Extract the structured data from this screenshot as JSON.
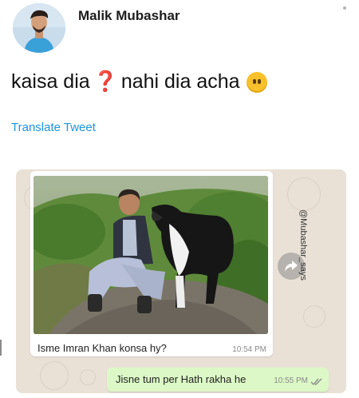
{
  "tweet": {
    "author": "Malik Mubashar",
    "text_part1": "kaisa dia",
    "question_mark": "❓",
    "text_part2": "nahi dia acha",
    "translate_label": "Translate Tweet"
  },
  "chat": {
    "incoming": {
      "caption": "Isme Imran Khan konsa hy?",
      "time": "10:54 PM"
    },
    "outgoing": {
      "text": "Jisne tum per Hath rakha he",
      "time": "10:55 PM"
    },
    "watermark": "@Mubashar_says"
  },
  "icons": {
    "emoji": "neutral-face-emoji-icon",
    "forward": "forward-arrow-icon",
    "ticks": "double-check-icon"
  },
  "colors": {
    "link": "#1b95e0",
    "chat_background": "#e9e1d6",
    "outgoing_bubble": "#dcf8c6",
    "incoming_bubble": "#ffffff"
  }
}
